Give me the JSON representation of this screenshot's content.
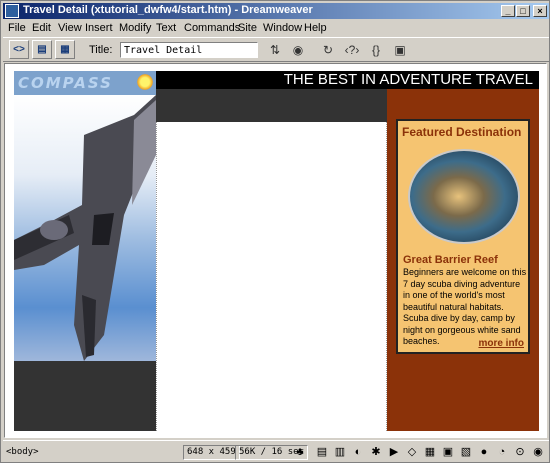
{
  "window": {
    "title": "Travel Detail (xtutorial_dwfw4/start.htm) - Dreamweaver",
    "minimize": "_",
    "maximize": "□",
    "close": "×"
  },
  "menu": [
    "File",
    "Edit",
    "View",
    "Insert",
    "Modify",
    "Text",
    "Commands",
    "Site",
    "Window",
    "Help"
  ],
  "toolbar": {
    "title_label": "Title:",
    "title_value": "Travel Detail"
  },
  "page": {
    "logo_text": "COMPASS",
    "banner": "THE BEST IN ADVENTURE TRAVEL",
    "featured_title": "Featured Destination",
    "place_name": "Great Barrier Reef",
    "place_desc": "Beginners are welcome on this 7 day scuba diving adventure in one of the world's most beautiful natural habitats. Scuba dive by day, camp by night on gorgeous white sand beaches.",
    "more_info": "more info"
  },
  "status": {
    "tag": "<body>",
    "size": "648 x 459",
    "download": "56K / 16 sec"
  },
  "icons": {
    "code_view": "code-view-icon",
    "design_view": "design-view-icon",
    "split_view": "split-view-icon"
  }
}
